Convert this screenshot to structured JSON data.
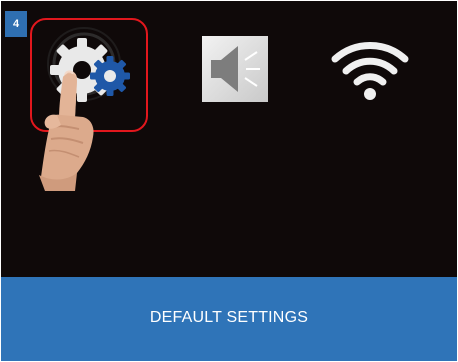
{
  "step": {
    "number": "4"
  },
  "menu": {
    "items": [
      {
        "icon": "gear-settings-icon",
        "selected": true
      },
      {
        "icon": "speaker-icon",
        "selected": false
      },
      {
        "icon": "wifi-icon",
        "selected": false
      }
    ]
  },
  "footer": {
    "label": "DEFAULT SETTINGS"
  },
  "colors": {
    "background": "#0f0909",
    "accent_blue": "#2f74b8",
    "selection_ring": "#e2171d",
    "gear_blue": "#1f58a8"
  }
}
